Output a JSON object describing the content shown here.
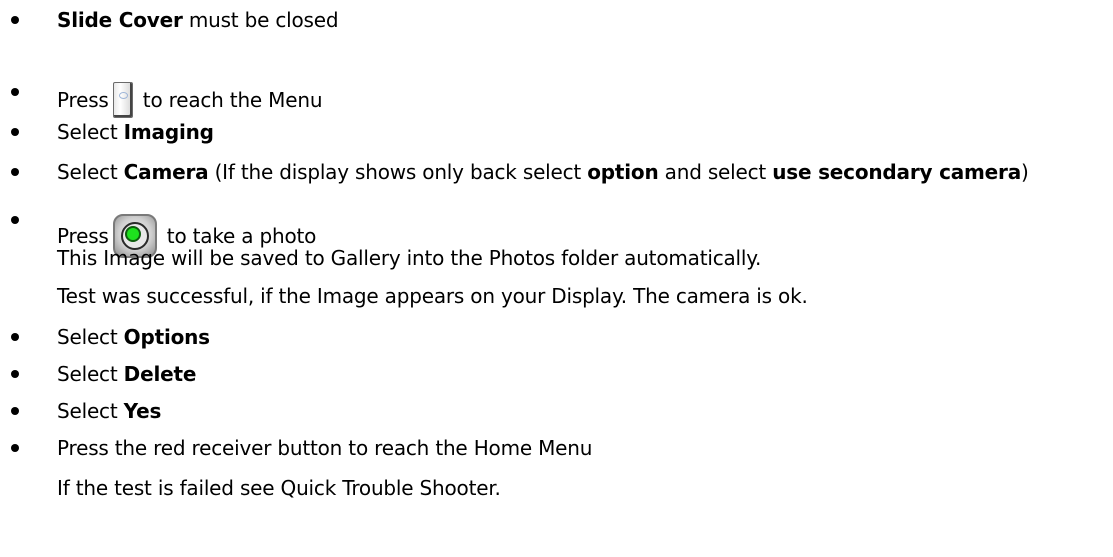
{
  "steps": [
    {
      "bold": "Slide Cover",
      "rest": " must be closed"
    },
    {
      "pre": "Press",
      "post": " to reach the Menu",
      "icon": "menu-key-icon"
    },
    {
      "pre": "Select ",
      "bold": "Imaging"
    },
    {
      "pre": "Select ",
      "bold": "Camera",
      "mid": " (If the display shows only back select ",
      "bold2": "option",
      "mid2": " and select ",
      "bold3": "use secondary camera",
      "post": ")"
    },
    {
      "pre": "Press",
      "post": " to take a photo",
      "icon": "capture-key-icon"
    },
    {
      "pre": "Select ",
      "bold": "Options"
    },
    {
      "pre": "Select ",
      "bold": "Delete"
    },
    {
      "pre": "Select ",
      "bold": "Yes"
    },
    {
      "text": "Press the red receiver button to reach the Home Menu"
    }
  ],
  "notes": {
    "saved": "This Image will be saved to Gallery into the Photos folder automatically.",
    "success": "Test was successful, if the Image appears on your Display. The camera is ok.",
    "failed": "If the test is failed see Quick Trouble Shooter."
  }
}
